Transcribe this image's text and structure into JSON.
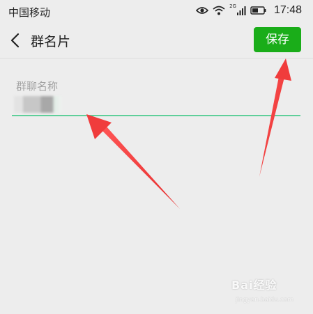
{
  "status_bar": {
    "carrier": "中国移动",
    "network": "2G",
    "time": "17:48"
  },
  "nav": {
    "title": "群名片",
    "back_icon": "chevron-left-icon",
    "save_label": "保存"
  },
  "form": {
    "label": "群聊名称",
    "value_obscured": true
  },
  "colors": {
    "accent": "#1aad19",
    "underline": "#5fcf9a",
    "background": "#ededed",
    "arrow": "#f03c3c"
  },
  "watermark": {
    "text": "Bai经验",
    "subtext": "jingyan.baidu.com"
  }
}
